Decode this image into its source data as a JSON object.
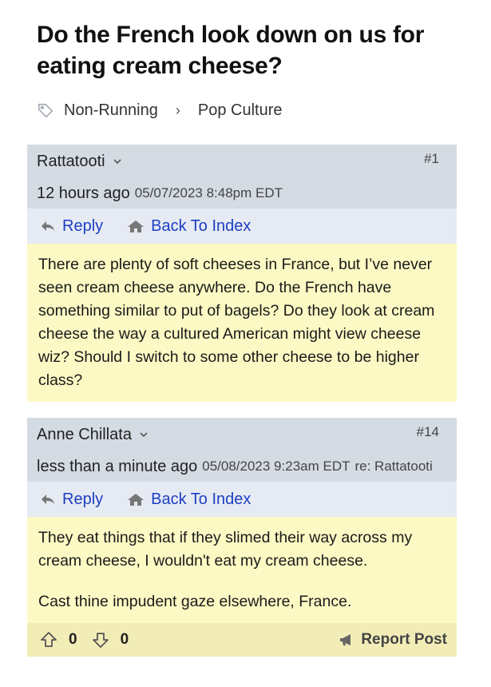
{
  "thread": {
    "title": "Do the French look down on us for eating cream cheese?"
  },
  "breadcrumb": {
    "category": "Non-Running",
    "subcategory": "Pop Culture",
    "icon": "tag-icon"
  },
  "posts": [
    {
      "author": "Rattatooti",
      "number": "#1",
      "relative_time": "12 hours ago",
      "timestamp": "05/07/2023 8:48pm EDT",
      "reply_to": "",
      "reply_label": "Reply",
      "back_label": "Back To Index",
      "paragraphs": [
        "There are plenty of soft cheeses in France, but I’ve never seen cream cheese anywhere. Do the French have something similar to put of bagels? Do they look at cream cheese the way a cultured American might view cheese wiz? Should I switch to some other cheese to be higher class?"
      ]
    },
    {
      "author": "Anne Chillata",
      "number": "#14",
      "relative_time": "less than a minute ago",
      "timestamp": "05/08/2023 9:23am EDT",
      "reply_to": "re: Rattatooti",
      "reply_label": "Reply",
      "back_label": "Back To Index",
      "paragraphs": [
        "They eat things that if they slimed their way across my cream cheese, I wouldn't eat my cream cheese.",
        "Cast thine impudent gaze elsewhere, France."
      ],
      "upvotes": "0",
      "downvotes": "0",
      "report_label": "Report Post"
    }
  ],
  "colors": {
    "header_bg": "#d5dbe3",
    "actions_bg": "#e6eaf2",
    "body_bg": "#fdf9c4",
    "link": "#1c3fc4"
  }
}
